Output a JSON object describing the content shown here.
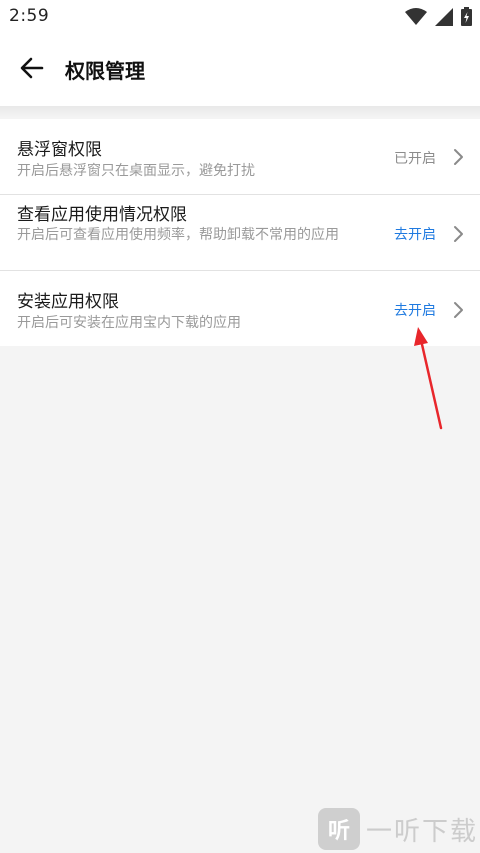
{
  "status_bar": {
    "time": "2:59",
    "icons": [
      "wifi-icon",
      "signal-icon",
      "battery-icon"
    ]
  },
  "header": {
    "back_icon": "back-arrow-icon",
    "title": "权限管理"
  },
  "permissions": [
    {
      "title": "悬浮窗权限",
      "description": "开启后悬浮窗只在桌面显示，避免打扰",
      "status": "已开启",
      "status_color": "#8c8c8c"
    },
    {
      "title": "查看应用使用情况权限",
      "description": "开启后可查看应用使用频率，帮助卸载不常用的应用",
      "status": "去开启",
      "status_color": "#1f7ae0"
    },
    {
      "title": "安装应用权限",
      "description": "开启后可安装在应用宝内下载的应用",
      "status": "去开启",
      "status_color": "#1f7ae0"
    }
  ],
  "watermark": {
    "logo": "听",
    "text": "一听下载"
  },
  "colors": {
    "accent": "#1f7ae0",
    "annotation_arrow": "#e8262b"
  }
}
